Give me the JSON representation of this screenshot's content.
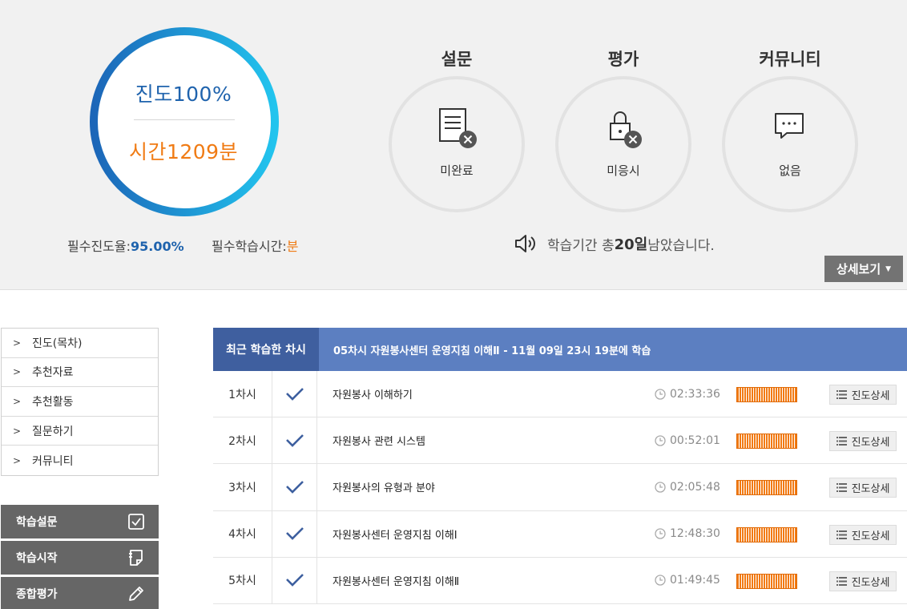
{
  "summary": {
    "progress_text": "진도100%",
    "time_text": "시간1209분",
    "progress_percent": 100,
    "required_progress_label": "필수진도율:",
    "required_progress_value": "95.00%",
    "required_time_label": "필수학습시간:",
    "required_time_value": "분"
  },
  "status": [
    {
      "title": "설문",
      "label": "미완료",
      "icon": "survey-icon"
    },
    {
      "title": "평가",
      "label": "미응시",
      "icon": "lock-icon"
    },
    {
      "title": "커뮤니티",
      "label": "없음",
      "icon": "chat-icon"
    }
  ],
  "period": {
    "prefix": "학습기간 총 ",
    "days": "20일",
    "suffix": " 남았습니다."
  },
  "detail_button": "상세보기",
  "side_menu": [
    {
      "label": "진도(목차)"
    },
    {
      "label": "추천자료"
    },
    {
      "label": "추천활동"
    },
    {
      "label": "질문하기"
    },
    {
      "label": "커뮤니티"
    }
  ],
  "actions": [
    {
      "label": "학습설문",
      "icon": "checkbox-icon"
    },
    {
      "label": "학습시작",
      "icon": "note-icon"
    },
    {
      "label": "종합평가",
      "icon": "pencil-icon"
    }
  ],
  "recent": {
    "label": "최근 학습한 차시",
    "text": "05차시 자원봉사센터 운영지침 이해Ⅱ - 11월 09일 23시 19분에 학습"
  },
  "lessons": [
    {
      "num": "1차시",
      "title": "자원봉사 이해하기",
      "time": "02:33:36",
      "progress": 100,
      "detail": "진도상세"
    },
    {
      "num": "2차시",
      "title": "자원봉사 관련 시스템",
      "time": "00:52:01",
      "progress": 100,
      "detail": "진도상세"
    },
    {
      "num": "3차시",
      "title": "자원봉사의 유형과 분야",
      "time": "02:05:48",
      "progress": 100,
      "detail": "진도상세"
    },
    {
      "num": "4차시",
      "title": "자원봉사센터 운영지침 이해Ⅰ",
      "time": "12:48:30",
      "progress": 100,
      "detail": "진도상세"
    },
    {
      "num": "5차시",
      "title": "자원봉사센터 운영지침 이해Ⅱ",
      "time": "01:49:45",
      "progress": 100,
      "detail": "진도상세"
    }
  ],
  "colors": {
    "progress_blue": "#1f63ad",
    "time_orange": "#f07b14",
    "header_blue": "#5c7fc1",
    "header_dark_blue": "#3f5f9f",
    "bar_orange": "#f27a12"
  }
}
